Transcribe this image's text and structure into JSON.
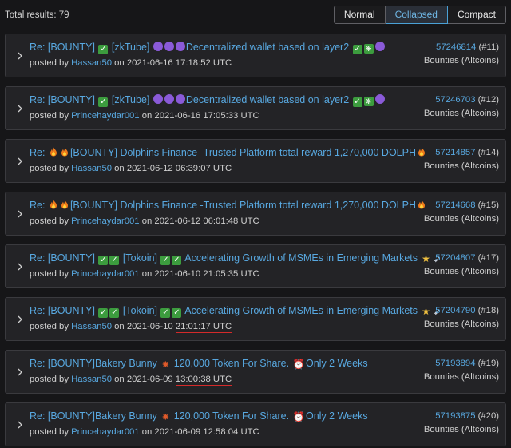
{
  "results": {
    "total_label": "Total results: 79"
  },
  "view_modes": [
    {
      "label": "Normal",
      "active": false
    },
    {
      "label": "Collapsed",
      "active": true
    },
    {
      "label": "Compact",
      "active": false
    }
  ],
  "posts": [
    {
      "title_parts": [
        "Re: [BOUNTY] ",
        "check",
        " [zkTube] ",
        "circle",
        "circle",
        "circle",
        "Decentralized wallet based on layer2 ",
        "check",
        "snow",
        "circle"
      ],
      "posted_by_label": "posted by",
      "author": "Hassan50",
      "on_label": "on",
      "date": "2021-06-16",
      "time": "17:18:52",
      "tz": "UTC",
      "time_underlined": false,
      "post_id": "57246814",
      "post_index": "(#11)",
      "board": "Bounties (Altcoins)"
    },
    {
      "title_parts": [
        "Re: [BOUNTY] ",
        "check",
        " [zkTube] ",
        "circle",
        "circle",
        "circle",
        "Decentralized wallet based on layer2 ",
        "check",
        "snow",
        "circle"
      ],
      "posted_by_label": "posted by",
      "author": "Princehaydar001",
      "on_label": "on",
      "date": "2021-06-16",
      "time": "17:05:33",
      "tz": "UTC",
      "time_underlined": false,
      "post_id": "57246703",
      "post_index": "(#12)",
      "board": "Bounties (Altcoins)"
    },
    {
      "title_parts": [
        "Re: ",
        "fire",
        "fire",
        "[BOUNTY] Dolphins Finance -Trusted Platform total reward 1,270,000 DOLPH",
        "fire"
      ],
      "posted_by_label": "posted by",
      "author": "Hassan50",
      "on_label": "on",
      "date": "2021-06-12",
      "time": "06:39:07",
      "tz": "UTC",
      "time_underlined": false,
      "post_id": "57214857",
      "post_index": "(#14)",
      "board": "Bounties (Altcoins)"
    },
    {
      "title_parts": [
        "Re: ",
        "fire",
        "fire",
        "[BOUNTY] Dolphins Finance -Trusted Platform total reward 1,270,000 DOLPH",
        "fire"
      ],
      "posted_by_label": "posted by",
      "author": "Princehaydar001",
      "on_label": "on",
      "date": "2021-06-12",
      "time": "06:01:48",
      "tz": "UTC",
      "time_underlined": false,
      "post_id": "57214668",
      "post_index": "(#15)",
      "board": "Bounties (Altcoins)"
    },
    {
      "title_parts": [
        "Re: [BOUNTY] ",
        "check",
        "check",
        " [Tokoin] ",
        "check",
        "check",
        " Accelerating Growth of MSMEs in Emerging Markets ",
        "star",
        "rocket"
      ],
      "posted_by_label": "posted by",
      "author": "Princehaydar001",
      "on_label": "on",
      "date": "2021-06-10",
      "time": "21:05:35",
      "tz": "UTC",
      "time_underlined": true,
      "post_id": "57204807",
      "post_index": "(#17)",
      "board": "Bounties (Altcoins)"
    },
    {
      "title_parts": [
        "Re: [BOUNTY] ",
        "check",
        "check",
        " [Tokoin] ",
        "check",
        "check",
        " Accelerating Growth of MSMEs in Emerging Markets ",
        "star",
        "rocket"
      ],
      "posted_by_label": "posted by",
      "author": "Hassan50",
      "on_label": "on",
      "date": "2021-06-10",
      "time": "21:01:17",
      "tz": "UTC",
      "time_underlined": true,
      "post_id": "57204790",
      "post_index": "(#18)",
      "board": "Bounties (Altcoins)"
    },
    {
      "title_parts": [
        "Re: [BOUNTY]Bakery Bunny ",
        "boom",
        " 120,000 Token For Share. ",
        "clock",
        " Only 2 Weeks"
      ],
      "posted_by_label": "posted by",
      "author": "Hassan50",
      "on_label": "on",
      "date": "2021-06-09",
      "time": "13:00:38",
      "tz": "UTC",
      "time_underlined": true,
      "post_id": "57193894",
      "post_index": "(#19)",
      "board": "Bounties (Altcoins)"
    },
    {
      "title_parts": [
        "Re: [BOUNTY]Bakery Bunny ",
        "boom",
        " 120,000 Token For Share. ",
        "clock",
        " Only 2 Weeks"
      ],
      "posted_by_label": "posted by",
      "author": "Princehaydar001",
      "on_label": "on",
      "date": "2021-06-09",
      "time": "12:58:04",
      "tz": "UTC",
      "time_underlined": true,
      "post_id": "57193875",
      "post_index": "(#20)",
      "board": "Bounties (Altcoins)"
    }
  ],
  "emoji_icons": {
    "check": "check-mark-icon",
    "circle": "purple-circle-icon",
    "snow": "sparkle-icon",
    "fire": "fire-icon",
    "star": "star-icon",
    "rocket": "rocket-icon",
    "boom": "collision-icon",
    "clock": "alarm-clock-icon"
  },
  "colors": {
    "link": "#58a8e0",
    "background": "#161618",
    "card": "#232326",
    "underline_annotation": "#d42a2a",
    "active_toggle": "#4aa1d6"
  }
}
